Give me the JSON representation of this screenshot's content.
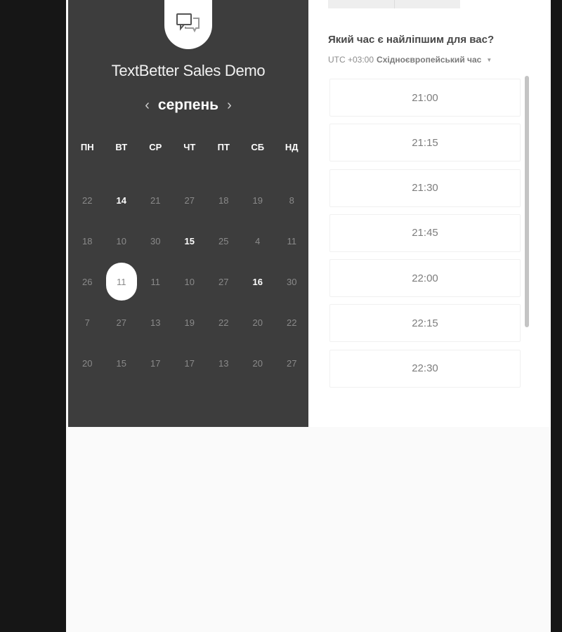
{
  "event": {
    "title": "TextBetter Sales Demo",
    "logo_icon": "chat-bubbles-icon"
  },
  "calendar": {
    "month": "серпень",
    "prev_icon": "‹",
    "next_icon": "›",
    "weekdays": [
      "ПН",
      "ВТ",
      "СР",
      "ЧТ",
      "ПТ",
      "СБ",
      "НД"
    ],
    "weeks": [
      [
        "22",
        "14",
        "21",
        "27",
        "18",
        "19",
        "8"
      ],
      [
        "18",
        "10",
        "30",
        "15",
        "25",
        "4",
        "11"
      ],
      [
        "26",
        "11",
        "11",
        "10",
        "27",
        "16",
        "30"
      ],
      [
        "7",
        "27",
        "13",
        "19",
        "22",
        "20",
        "22"
      ],
      [
        "20",
        "15",
        "17",
        "17",
        "13",
        "20",
        "27"
      ]
    ],
    "available_days": [
      "14",
      "15",
      "16"
    ],
    "selected_day": "11"
  },
  "schedule": {
    "question": "Який час є найліпшим для вас?",
    "timezone_offset": "UTC +03:00",
    "timezone_name": "Східноєвропейський час",
    "slots": [
      "21:00",
      "21:15",
      "21:30",
      "21:45",
      "22:00",
      "22:15",
      "22:30"
    ]
  },
  "colors": {
    "panel_dark": "#3d3d3d",
    "page_bg": "#161616",
    "accent_white": "#ffffff"
  }
}
